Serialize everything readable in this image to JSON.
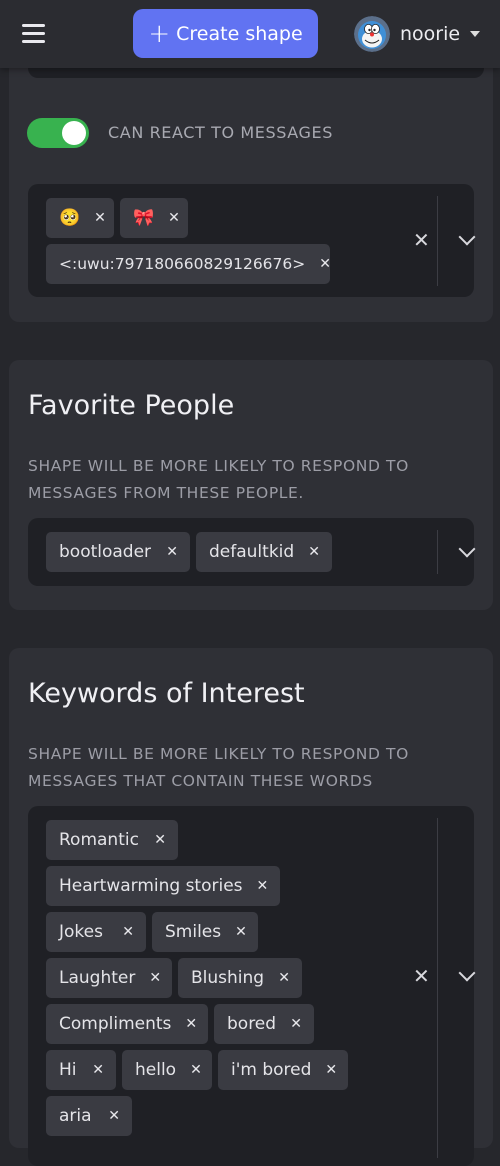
{
  "header": {
    "create_label": "Create shape",
    "username": "noorie",
    "avatar_icon": "user-avatar-icon"
  },
  "react_section": {
    "toggle_label": "CAN REACT TO MESSAGES",
    "toggle_on": true,
    "reactions": [
      "🥺",
      "🎀",
      "<:uwu:797180660829126676>"
    ]
  },
  "favorite_people": {
    "title": "Favorite People",
    "description": "SHAPE WILL BE MORE LIKELY TO RESPOND TO MESSAGES FROM THESE PEOPLE.",
    "people": [
      "bootloader",
      "defaultkid"
    ]
  },
  "keywords": {
    "title": "Keywords of Interest",
    "description": "SHAPE WILL BE MORE LIKELY TO RESPOND TO MESSAGES THAT CONTAIN THESE WORDS",
    "items": [
      "Romantic",
      "Heartwarming stories",
      "Jokes",
      "Smiles",
      "Laughter",
      "Blushing",
      "Compliments",
      "bored",
      "Hi",
      "hello",
      "i'm bored",
      "aria"
    ]
  },
  "colors": {
    "accent": "#6173f2",
    "toggle_on": "#38b24f",
    "background": "#26272c",
    "card": "#2f3036",
    "input": "#1f2025",
    "chip": "#3a3b42"
  }
}
